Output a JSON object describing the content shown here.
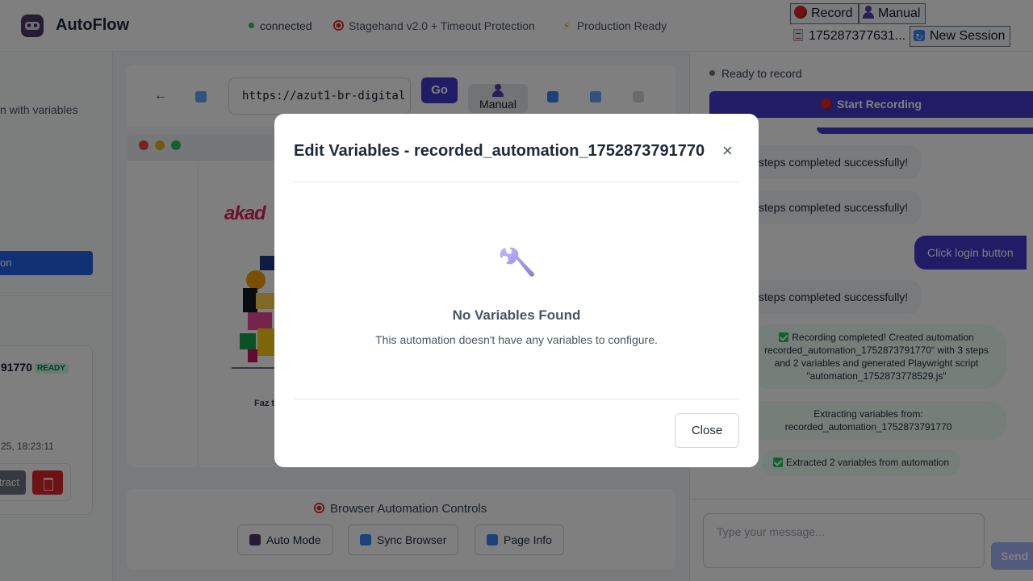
{
  "header": {
    "app_name": "AutoFlow",
    "status_connected": "connected",
    "status_stagehand": "Stagehand v2.0 + Timeout Protection",
    "status_production": "Production Ready",
    "record_label": "Record",
    "manual_label": "Manual",
    "session_id": "175287377631...",
    "new_session_label": "New Session"
  },
  "left": {
    "partial_text": "n with variables",
    "partial_button": "on",
    "card_title": "91770",
    "card_badge": "READY",
    "card_date": "25, 18:23:11",
    "extract_label": "xtract"
  },
  "browser": {
    "back_label": "←",
    "url": "https://azut1-br-digital",
    "go_label": "Go",
    "manual_label": "Manual",
    "site_logo": "akad",
    "site_text": "Faz t"
  },
  "controls": {
    "title": "Browser Automation Controls",
    "auto_mode": "Auto Mode",
    "sync_browser": "Sync Browser",
    "page_info": "Page Info"
  },
  "chat": {
    "status": "Ready to record",
    "start_recording": "Start Recording",
    "messages": [
      "steps completed successfully!",
      "steps completed successfully!",
      "Click login button",
      "steps completed successfully!",
      "Recording completed! Created automation",
      "recorded_automation_1752873791770\" with 3 steps",
      "and 2 variables and generated Playwright script",
      "\"automation_1752873778529.js\"",
      "Extracting variables from:",
      "recorded_automation_1752873791770",
      "Extracted 2 variables from automation"
    ],
    "input_placeholder": "Type your message...",
    "send_label": "Send"
  },
  "modal": {
    "title": "Edit Variables - recorded_automation_1752873791770",
    "close_x": "×",
    "empty_title": "No Variables Found",
    "empty_text": "This automation doesn't have any variables to configure.",
    "close_label": "Close"
  },
  "colors": {
    "accent": "#4338ca",
    "connected_dot": "#22c55e",
    "record_red": "#dc2626",
    "link_blue": "#2563eb"
  }
}
